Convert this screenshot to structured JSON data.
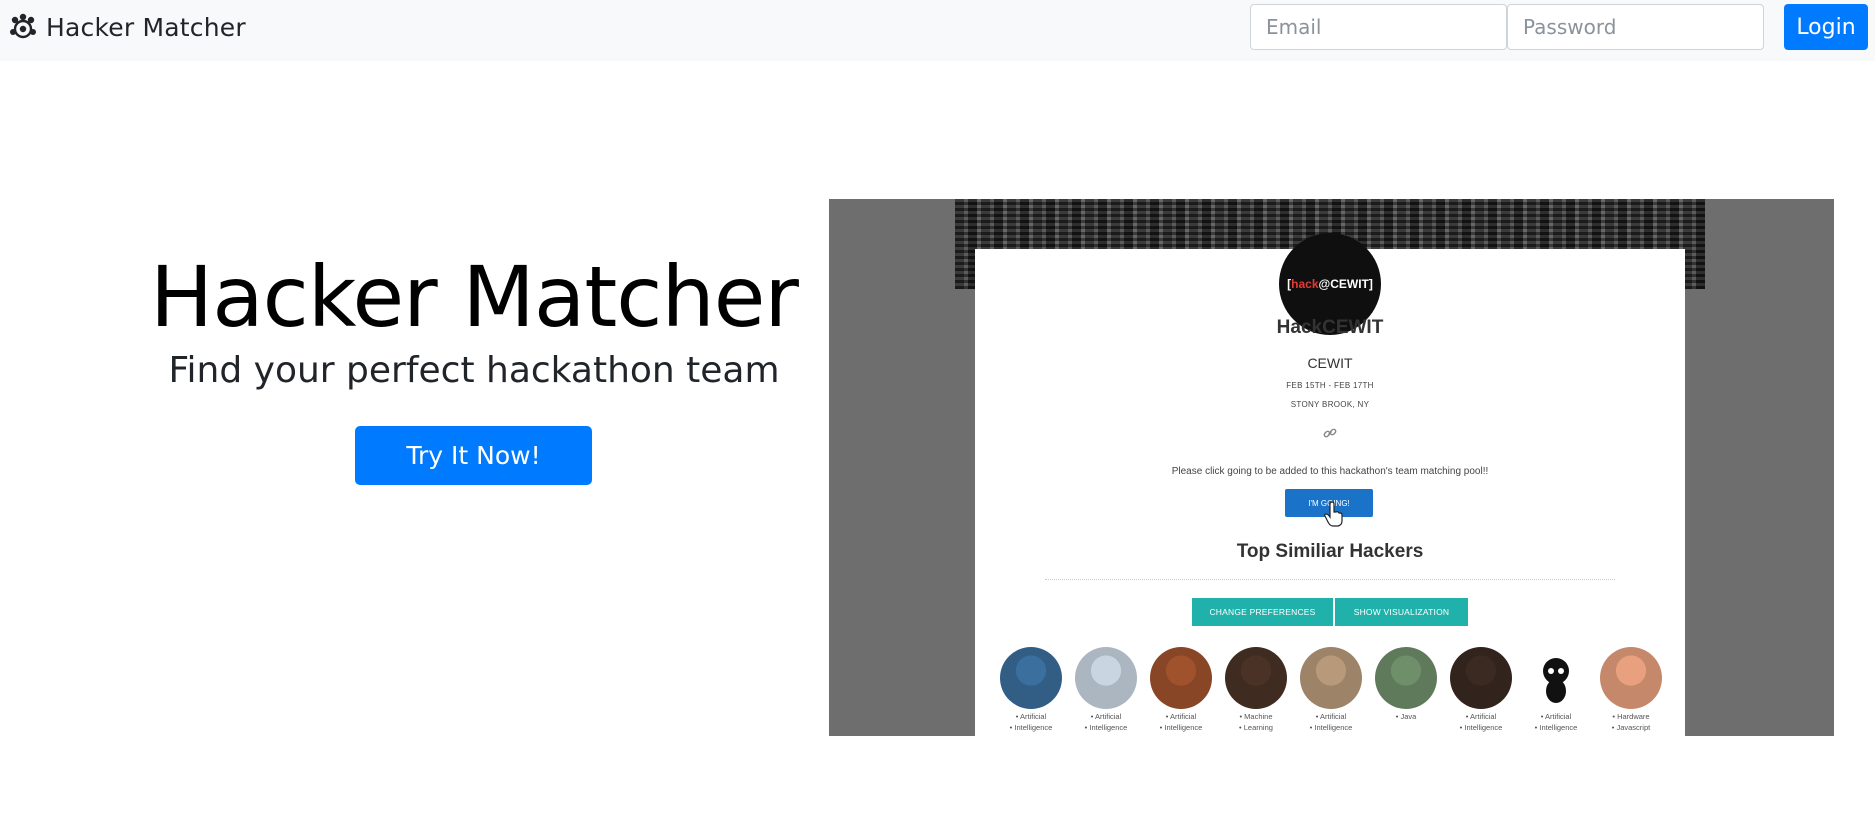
{
  "navbar": {
    "brand": "Hacker Matcher",
    "brand_icon": "team-icon",
    "email_placeholder": "Email",
    "password_placeholder": "Password",
    "login_label": "Login"
  },
  "hero": {
    "title": "Hacker Matcher",
    "subtitle": "Find your perfect hackathon team",
    "cta_label": "Try It Now!"
  },
  "preview": {
    "logo_prefix": "[",
    "logo_hack": "hack",
    "logo_suffix": "@CEWIT]",
    "event_title": "HackCEWIT",
    "org": "CEWIT",
    "dates": "FEB 15TH - FEB 17TH",
    "location": "STONY BROOK, NY",
    "link_icon": "link-icon",
    "message": "Please click going to be added to this hackathon's team matching pool!!",
    "going_label": "I'M GOING!",
    "similar_title": "Top Similiar Hackers",
    "change_prefs_label": "CHANGE PREFERENCES",
    "show_viz_label": "SHOW VISUALIZATION",
    "hackers": [
      {
        "skills": [
          "Artificial",
          "Intelligence"
        ],
        "color": "#3b6f9e"
      },
      {
        "skills": [
          "Artificial",
          "Intelligence"
        ],
        "color": "#c9d6e2"
      },
      {
        "skills": [
          "Artificial",
          "Intelligence"
        ],
        "color": "#a0522d"
      },
      {
        "skills": [
          "Machine",
          "Learning"
        ],
        "color": "#4a3326"
      },
      {
        "skills": [
          "Artificial",
          "Intelligence"
        ],
        "color": "#b89a7a"
      },
      {
        "skills": [
          "Java"
        ],
        "color": "#6f8f6a"
      },
      {
        "skills": [
          "Artificial",
          "Intelligence"
        ],
        "color": "#3a2a22"
      },
      {
        "skills": [
          "Artificial",
          "Intelligence"
        ],
        "color": "#ffffff"
      },
      {
        "skills": [
          "Hardware",
          "Javascript"
        ],
        "color": "#e8a07e"
      }
    ]
  },
  "colors": {
    "primary": "#007bff",
    "navbar_bg": "#f8f9fa",
    "teal": "#20b2aa"
  }
}
